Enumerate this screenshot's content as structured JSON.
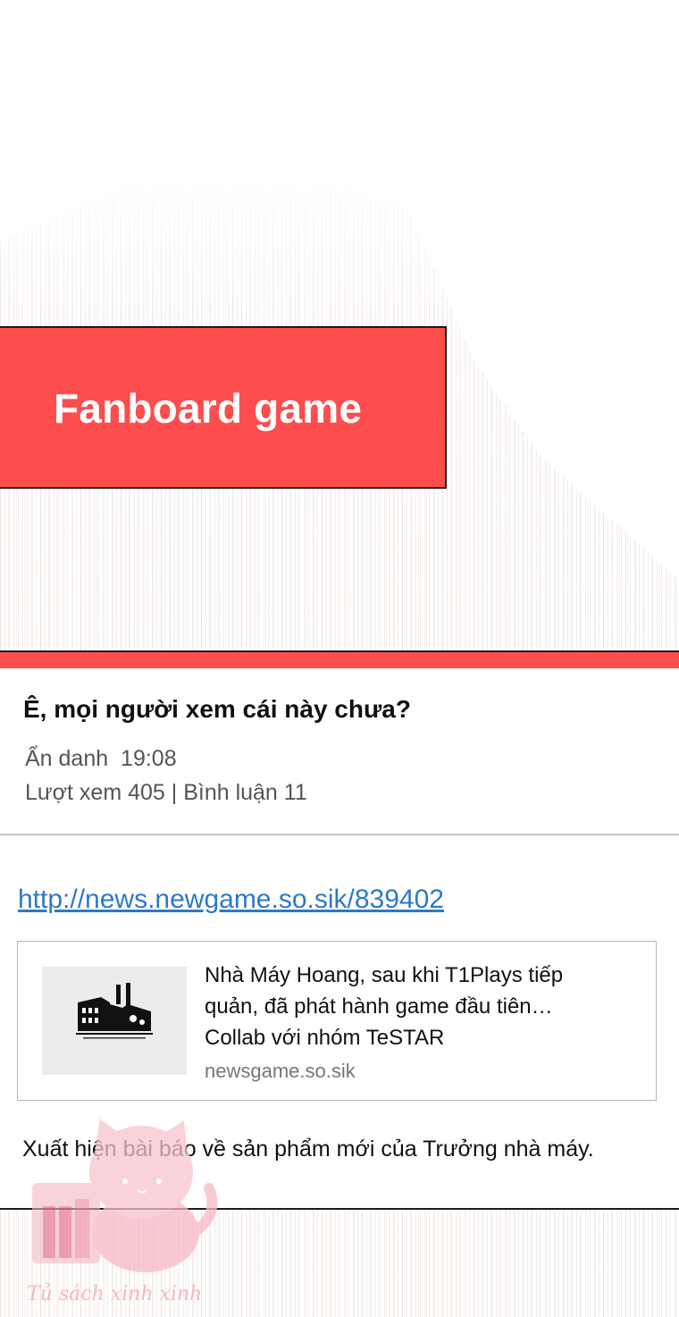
{
  "header": {
    "board_title": "Fanboard game"
  },
  "post": {
    "title": "Ê, mọi người xem cái này chưa?",
    "author": "Ẩn danh",
    "time": "19:08",
    "stats": "Lượt xem 405 | Bình luận 11",
    "link": "http://news.newgame.so.sik/839402",
    "preview": {
      "title_line1": "Nhà Máy Hoang, sau khi T1Plays tiếp",
      "title_line2": "quản, đã phát hành game đầu tiên…",
      "title_line3": "Collab với nhóm TeSTAR",
      "domain": "newsgame.so.sik",
      "thumbnail_icon": "factory-icon"
    },
    "body": "Xuất hiện bài báo về sản phẩm mới của Trưởng nhà máy."
  },
  "watermark": {
    "text": "Tủ sách xinh xinh"
  },
  "colors": {
    "accent_red": "#fd4d4d",
    "link_blue": "#2d79c7",
    "watermark_pink": "#f2a1b0"
  }
}
